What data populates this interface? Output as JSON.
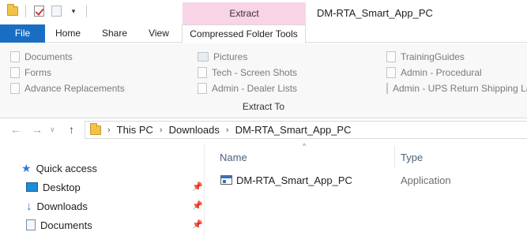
{
  "window": {
    "title": "DM-RTA_Smart_App_PC",
    "context_tab_header": "Extract"
  },
  "quick_access_toolbar": {
    "icons": [
      "folder-icon",
      "properties-check-icon",
      "new-folder-icon",
      "customize-dropdown-icon"
    ],
    "dropdown_glyph": "▾"
  },
  "ribbon_tabs": [
    {
      "label": "File"
    },
    {
      "label": "Home"
    },
    {
      "label": "Share"
    },
    {
      "label": "View"
    },
    {
      "label": "Compressed Folder Tools"
    }
  ],
  "ribbon": {
    "destinations": [
      [
        "Documents",
        "Forms",
        "Advance Replacements"
      ],
      [
        "Pictures",
        "Tech - Screen Shots",
        "Admin - Dealer Lists"
      ],
      [
        "TrainingGuides",
        "Admin - Procedural",
        "Admin - UPS Return Shipping Labels"
      ]
    ],
    "group_label": "Extract To"
  },
  "navigation": {
    "back_glyph": "←",
    "forward_glyph": "→",
    "recent_glyph": "∨",
    "up_glyph": "↑",
    "breadcrumb": [
      "This PC",
      "Downloads",
      "DM-RTA_Smart_App_PC"
    ],
    "crumb_separator": "›"
  },
  "nav_pane": {
    "quick_access": "Quick access",
    "items": [
      {
        "label": "Desktop",
        "pinned": true
      },
      {
        "label": "Downloads",
        "pinned": true
      },
      {
        "label": "Documents",
        "pinned": true
      }
    ],
    "pin_glyph": "📌"
  },
  "file_list": {
    "sort_glyph": "^",
    "columns": {
      "name": "Name",
      "type": "Type"
    },
    "rows": [
      {
        "name": "DM-RTA_Smart_App_PC",
        "type": "Application",
        "icon": "application-icon"
      }
    ]
  }
}
